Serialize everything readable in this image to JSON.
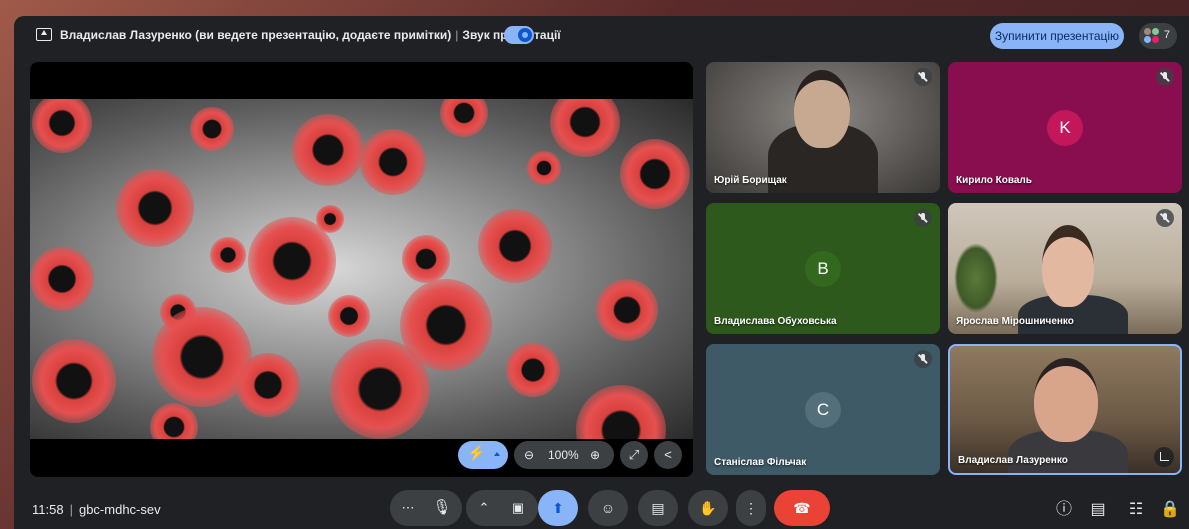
{
  "header": {
    "presenter_text": "Владислав Лазуренко (ви ведете презентацію, додаєте примітки)",
    "separator": "|",
    "sound_label": "Звук презентації",
    "stop_button_label": "Зупинити презентацію",
    "participant_count": "7"
  },
  "presentation": {
    "zoom_label": "100%"
  },
  "participants": [
    {
      "name": "Юрій Борищак",
      "muted": true,
      "camera": true
    },
    {
      "name": "Кирило Коваль",
      "muted": true,
      "camera": false,
      "initial": "K",
      "color": "#c2185b"
    },
    {
      "name": "Владислава Обуховська",
      "muted": true,
      "camera": false,
      "initial": "В",
      "color": "#33691e"
    },
    {
      "name": "Ярослав Мірошниченко",
      "muted": true,
      "camera": true
    },
    {
      "name": "Станіслав Фільчак",
      "muted": true,
      "camera": false,
      "initial": "С",
      "color": "#546e7a"
    },
    {
      "name": "Владислав Лазуренко",
      "muted": false,
      "camera": true
    }
  ],
  "footer": {
    "time": "11:58",
    "separator": "|",
    "meeting_code": "gbc-mdhc-sev"
  },
  "colors": {
    "background": "#202124",
    "accent": "#8ab4f8",
    "hangup": "#ea4335",
    "control": "#3c4043"
  }
}
